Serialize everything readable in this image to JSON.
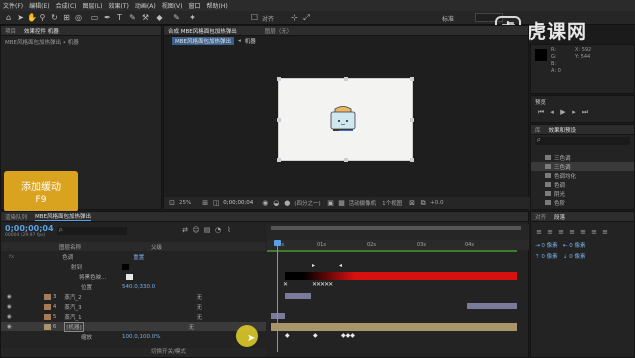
{
  "menu": [
    "文件(F)",
    "编辑(E)",
    "合成(C)",
    "图层(L)",
    "效果(T)",
    "动画(A)",
    "视图(V)",
    "窗口",
    "帮助(H)"
  ],
  "toolbar": {
    "align_label": "对齐",
    "workspace": "标准"
  },
  "watermark": {
    "text": "虎课网",
    "logo": "虎"
  },
  "project_panel": {
    "tabs": [
      "项目",
      "效果控件 机器"
    ],
    "path": "MBE风格面包加热弹出 • 机器"
  },
  "composition_panel": {
    "tabs": [
      "合成 MBE风格面包加热弹出",
      "图层（无）"
    ],
    "breadcrumb_comp": "MBE风格面包加热弹出",
    "breadcrumb_sep": "◂",
    "breadcrumb_layer": "机器",
    "bottom": {
      "zoom": "25%",
      "timecode": "0;00;00;04",
      "quality": "(四分之一)",
      "camera": "活动摄像机",
      "views": "1个视图",
      "plus": "+0.0"
    }
  },
  "info_panel": {
    "lines": [
      "X: 592",
      "Y: 544",
      "R:",
      "G:",
      "B:",
      "A: 0"
    ]
  },
  "preview_panel": {
    "title": "预览"
  },
  "effects_panel": {
    "tabs": [
      "库",
      "效果和预设"
    ],
    "search_placeholder": "ρ",
    "items": [
      "三色调",
      "三色调",
      "色调均化",
      "色调",
      "阴光",
      "色阶"
    ]
  },
  "paragraph_panel": {
    "tabs": [
      "对齐",
      "段落"
    ]
  },
  "overlay_box": {
    "title": "添加缓动",
    "shortcut": "F9"
  },
  "timeline": {
    "tabs": [
      "渲染队列",
      "MBE风格面包加热弹出"
    ],
    "timecode": "0;00;00;04",
    "fps": "00004 (29.97 fps)",
    "search_placeholder": "ρ.",
    "col_source": "图层名称",
    "col_mode": "父级",
    "ruler": [
      "00s",
      "01s",
      "02s",
      "03s",
      "04s"
    ],
    "rows": [
      {
        "num": "",
        "name": "色调",
        "sub": "重置",
        "parent": ""
      },
      {
        "num": "",
        "name": "射到",
        "sub": "",
        "parent": ""
      },
      {
        "num": "",
        "name": "将黑色映...",
        "sub": "",
        "parent": ""
      },
      {
        "num": "",
        "name": "位置",
        "sub": "540.0,330.0",
        "parent": ""
      },
      {
        "num": "3",
        "name": "蒸汽_2",
        "sub": "",
        "parent": "无"
      },
      {
        "num": "4",
        "name": "蒸汽_3",
        "sub": "",
        "parent": "无"
      },
      {
        "num": "5",
        "name": "蒸汽_1",
        "sub": "",
        "parent": "无"
      },
      {
        "num": "6",
        "name": "[机器]",
        "sub": "",
        "parent": "无"
      },
      {
        "num": "",
        "name": "缩放",
        "sub": "100.0,100.0%",
        "parent": ""
      }
    ],
    "footer": "切换开关/模式"
  },
  "colors": {
    "accent": "#d9a31f",
    "highlight": "#5aa0e6",
    "red": "#d71010"
  }
}
